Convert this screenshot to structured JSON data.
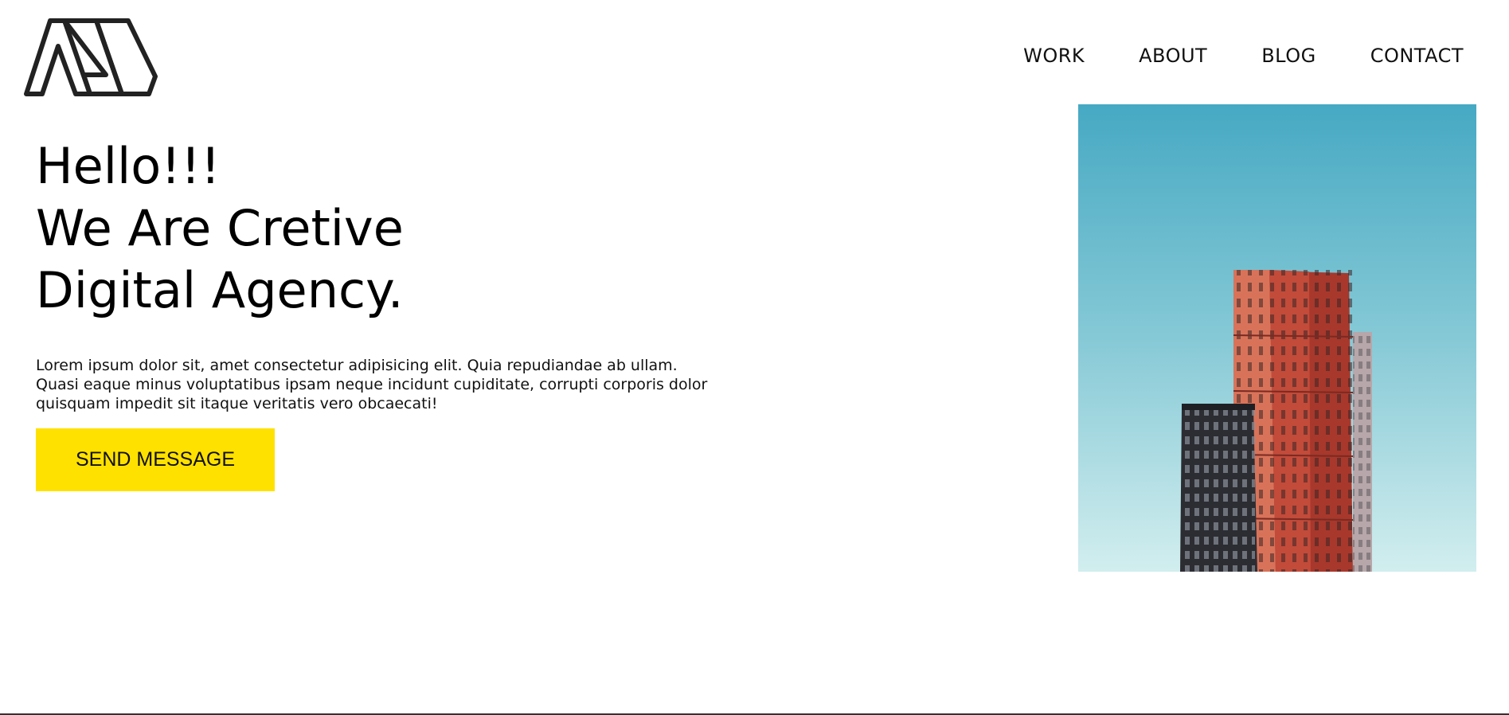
{
  "logo": {
    "icon": "stylized-m-logo-icon"
  },
  "nav": {
    "items": [
      {
        "label": "WORK"
      },
      {
        "label": "ABOUT"
      },
      {
        "label": "BLOG"
      },
      {
        "label": "CONTACT"
      }
    ]
  },
  "hero": {
    "title_lines": [
      "Hello!!!",
      "We Are Cretive",
      "Digital Agency."
    ],
    "paragraph_lines": [
      "Lorem ipsum dolor sit, amet consectetur adipisicing elit. Quia repudiandae ab ullam.",
      "Quasi eaque minus voluptatibus ipsam neque incidunt cupiditate, corrupti corporis dolor",
      "quisquam impedit sit itaque veritatis vero obcaecati!"
    ],
    "cta_label": "SEND MESSAGE",
    "image": "building-photo"
  },
  "colors": {
    "accent": "#FFE100",
    "text": "#111111",
    "background": "#FFFFFF",
    "sky_top": "#46A9C3",
    "sky_bottom": "#D2EEEF"
  }
}
